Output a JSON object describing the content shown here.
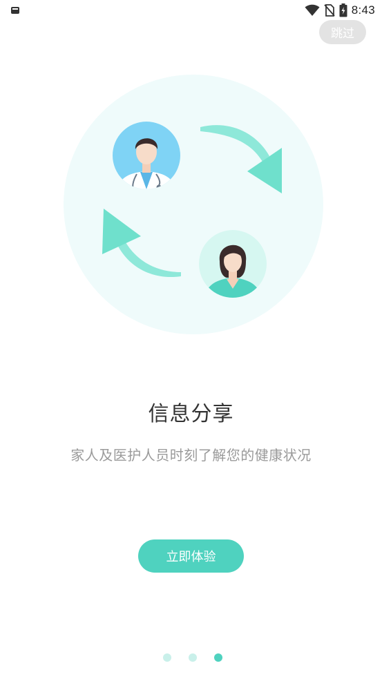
{
  "status_bar": {
    "time": "8:43",
    "left_icon": "notification-icon",
    "icons": [
      "wifi-icon",
      "no-sim-icon",
      "battery-charging-icon"
    ]
  },
  "skip": {
    "label": "跳过"
  },
  "illustration": {
    "description_icons": [
      "doctor-avatar-icon",
      "nurse-avatar-icon",
      "arrow-right-down-icon",
      "arrow-left-up-icon"
    ]
  },
  "onboarding": {
    "title": "信息分享",
    "subtitle": "家人及医护人员时刻了解您的健康状况",
    "cta_label": "立即体验"
  },
  "pager": {
    "total": 3,
    "active_index": 2
  },
  "colors": {
    "accent": "#4fd2bf",
    "circle_bg": "#effbfb",
    "skip_bg": "#e3e3e3",
    "dot_inactive": "#c9f0ea"
  }
}
